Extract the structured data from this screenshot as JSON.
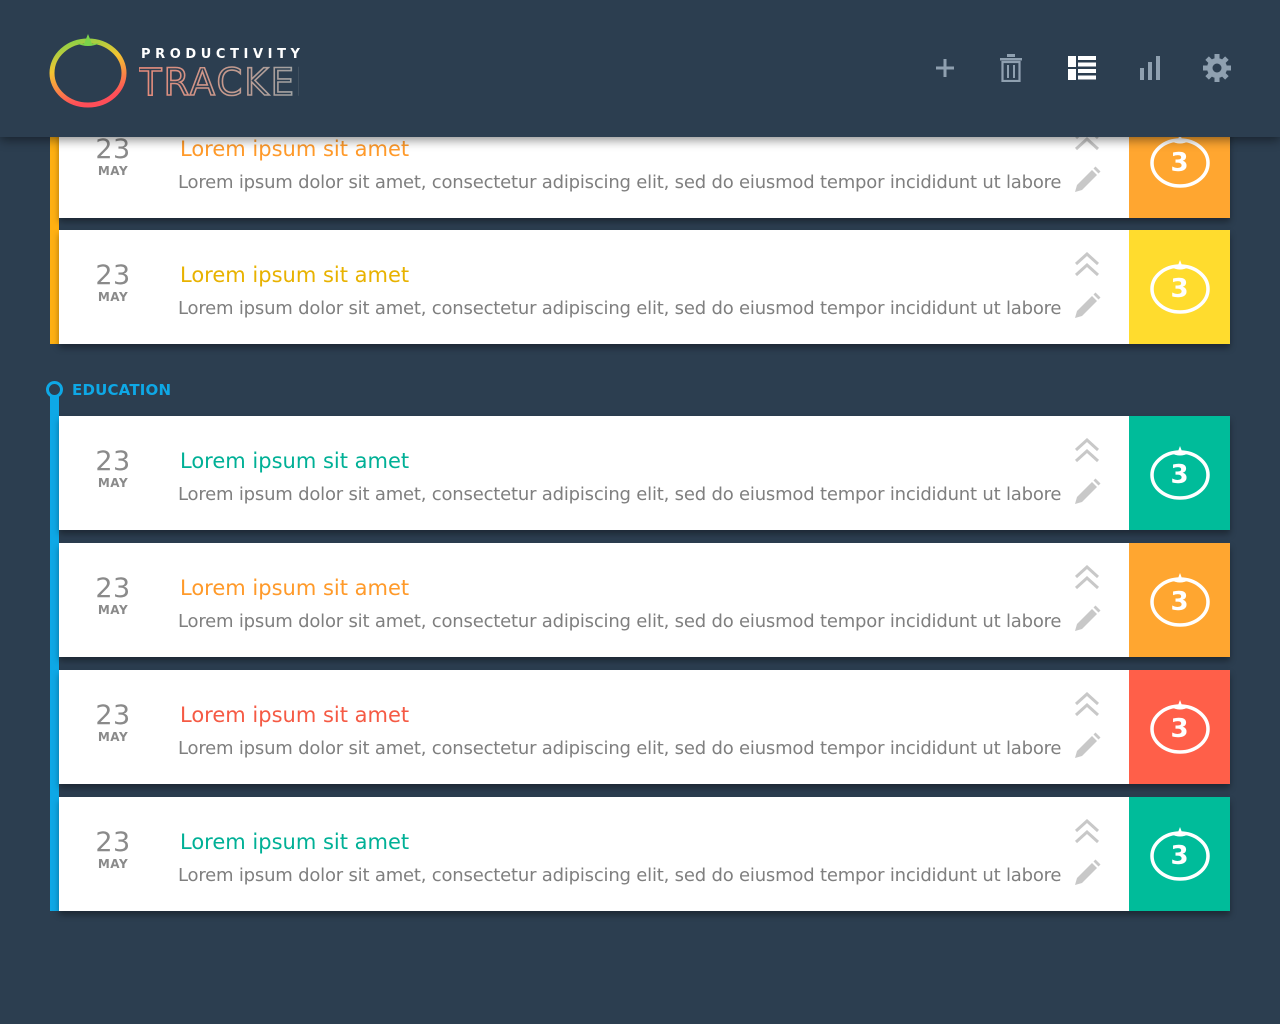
{
  "app": {
    "logo_top": "PRODUCTIVITY",
    "logo_bottom": "TRACKER"
  },
  "toolbar": {
    "items": [
      {
        "name": "add",
        "icon": "plus-icon",
        "active": false
      },
      {
        "name": "delete",
        "icon": "trash-icon",
        "active": false
      },
      {
        "name": "list-view",
        "icon": "list-icon",
        "active": true
      },
      {
        "name": "stats",
        "icon": "bar-chart-icon",
        "active": false
      },
      {
        "name": "settings",
        "icon": "gear-icon",
        "active": false
      }
    ]
  },
  "colors": {
    "background": "#2c3e50",
    "orange": "#ffa630",
    "yellow": "#ffdc2e",
    "yellow_text": "#e8b200",
    "teal": "#00bc9a",
    "red": "#ff5f49",
    "blue": "#0ea8e6",
    "icon_muted": "#8fa0b0",
    "icon_active": "#ffffff"
  },
  "groups": [
    {
      "label": "",
      "color": "#ffb012",
      "tasks": [
        {
          "day": "23",
          "month": "MAY",
          "title": "Lorem ipsum sit amet",
          "description": "Lorem ipsum dolor sit amet, consectetur adipiscing elit, sed do eiusmod tempor incididunt ut labore",
          "pomodoros": "3",
          "color": "#ffa630",
          "title_color": "#ff9a2a"
        },
        {
          "day": "23",
          "month": "MAY",
          "title": "Lorem ipsum sit amet",
          "description": "Lorem ipsum dolor sit amet, consectetur adipiscing elit, sed do eiusmod tempor incididunt ut labore",
          "pomodoros": "3",
          "color": "#ffdc2e",
          "title_color": "#e8b200"
        }
      ]
    },
    {
      "label": "EDUCATION",
      "color": "#0ea8e6",
      "tasks": [
        {
          "day": "23",
          "month": "MAY",
          "title": "Lorem ipsum sit amet",
          "description": "Lorem ipsum dolor sit amet, consectetur adipiscing elit, sed do eiusmod tempor incididunt ut labore",
          "pomodoros": "3",
          "color": "#00bc9a",
          "title_color": "#00b096"
        },
        {
          "day": "23",
          "month": "MAY",
          "title": "Lorem ipsum sit amet",
          "description": "Lorem ipsum dolor sit amet, consectetur adipiscing elit, sed do eiusmod tempor incididunt ut labore",
          "pomodoros": "3",
          "color": "#ffa630",
          "title_color": "#ff9a2a"
        },
        {
          "day": "23",
          "month": "MAY",
          "title": "Lorem ipsum sit amet",
          "description": "Lorem ipsum dolor sit amet, consectetur adipiscing elit, sed do eiusmod tempor incididunt ut labore",
          "pomodoros": "3",
          "color": "#ff5f49",
          "title_color": "#f55a44"
        },
        {
          "day": "23",
          "month": "MAY",
          "title": "Lorem ipsum sit amet",
          "description": "Lorem ipsum dolor sit amet, consectetur adipiscing elit, sed do eiusmod tempor incididunt ut labore",
          "pomodoros": "3",
          "color": "#00bc9a",
          "title_color": "#00b096"
        }
      ]
    }
  ]
}
